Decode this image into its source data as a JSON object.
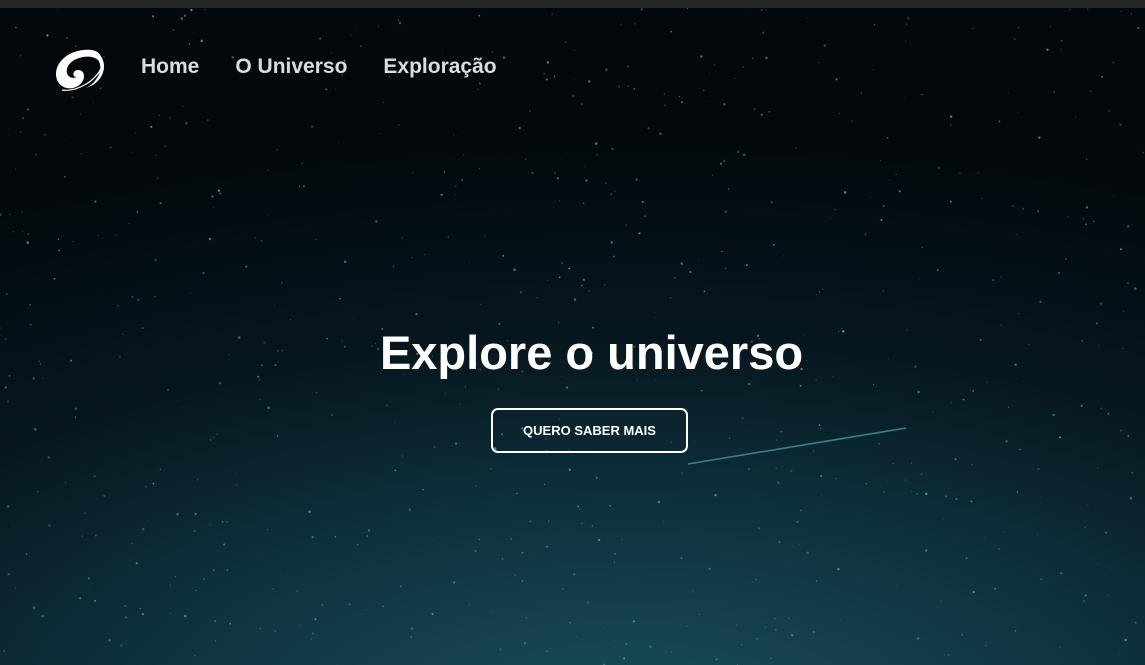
{
  "header": {
    "logo_icon": "galaxy-swirl-icon",
    "nav": [
      {
        "label": "Home"
      },
      {
        "label": "O Universo"
      },
      {
        "label": "Exploração"
      }
    ]
  },
  "hero": {
    "title": "Explore o universo",
    "cta_label": "QUERO SABER MAIS"
  }
}
